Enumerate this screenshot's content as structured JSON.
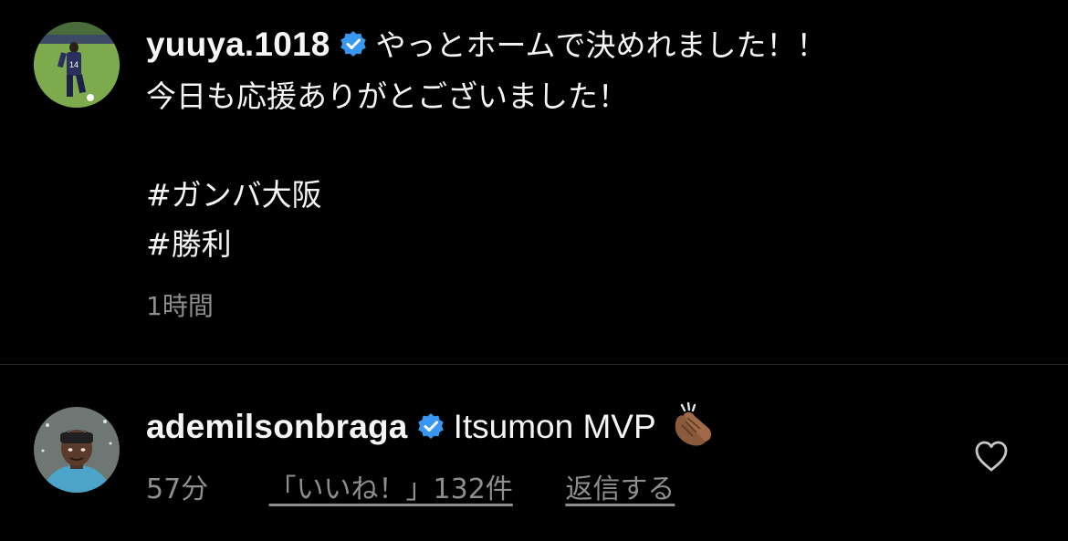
{
  "post": {
    "username": "yuuya.1018",
    "verified": true,
    "caption_lines": [
      "やっとホームで決めれました！！",
      "今日も応援ありがとございました！",
      "#ガンバ大阪",
      "#勝利"
    ],
    "time": "1時間"
  },
  "comment": {
    "username": "ademilsonbraga",
    "verified": true,
    "text": "Itsumon MVP",
    "emoji": "clapping-hands-icon",
    "time": "57分",
    "likes": "「いいね！」132件",
    "reply": "返信する"
  },
  "colors": {
    "background": "#000000",
    "text": "#f5f5f5",
    "secondary_text": "#8e8e8e",
    "verified_badge": "#3897f0",
    "divider": "#262626"
  }
}
